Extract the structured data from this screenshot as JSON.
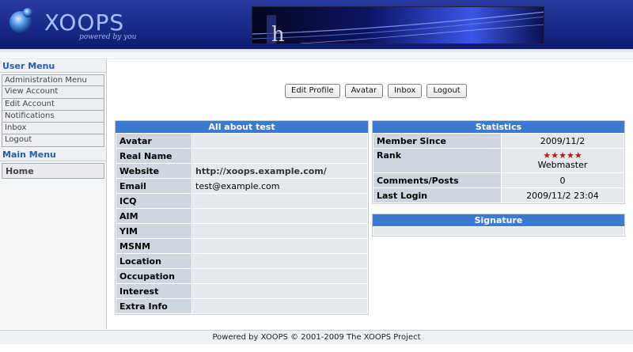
{
  "header": {
    "logo_text": "XOOPS",
    "logo_tagline": "powered by you",
    "banner_letter": "h"
  },
  "sidebar": {
    "user_menu_title": "User Menu",
    "user_menu_items": [
      {
        "label": "Administration Menu"
      },
      {
        "label": "View Account"
      },
      {
        "label": "Edit Account"
      },
      {
        "label": "Notifications"
      },
      {
        "label": "Inbox"
      },
      {
        "label": "Logout"
      }
    ],
    "main_menu_title": "Main Menu",
    "main_menu_items": [
      {
        "label": "Home"
      }
    ]
  },
  "actions": {
    "edit_profile": "Edit Profile",
    "avatar": "Avatar",
    "inbox": "Inbox",
    "logout": "Logout"
  },
  "about": {
    "title": "All about test",
    "rows": [
      {
        "label": "Avatar",
        "value": ""
      },
      {
        "label": "Real Name",
        "value": ""
      },
      {
        "label": "Website",
        "value": "http://xoops.example.com/"
      },
      {
        "label": "Email",
        "value": "test@example.com"
      },
      {
        "label": "ICQ",
        "value": ""
      },
      {
        "label": "AIM",
        "value": ""
      },
      {
        "label": "YIM",
        "value": ""
      },
      {
        "label": "MSNM",
        "value": ""
      },
      {
        "label": "Location",
        "value": ""
      },
      {
        "label": "Occupation",
        "value": ""
      },
      {
        "label": "Interest",
        "value": ""
      },
      {
        "label": "Extra Info",
        "value": ""
      }
    ]
  },
  "stats": {
    "title": "Statistics",
    "member_since_label": "Member Since",
    "member_since": "2009/11/2",
    "rank_label": "Rank",
    "rank_stars": 5,
    "rank_name": "Webmaster",
    "comments_label": "Comments/Posts",
    "comments": "0",
    "last_login_label": "Last Login",
    "last_login": "2009/11/2 23:04"
  },
  "signature": {
    "title": "Signature"
  },
  "footer": {
    "text": "Powered by XOOPS © 2001-2009 The XOOPS Project"
  },
  "colors": {
    "header_blue": "#1a2a8a",
    "panel_head": "#3a7ad0",
    "label_cell": "#cfd6df",
    "value_cell": "#e5e8ec",
    "menu_title": "#1f5fb8",
    "star_red": "#c21414"
  },
  "icons": {
    "logo": "xoops-orb-icon",
    "rank": "star-icon"
  }
}
